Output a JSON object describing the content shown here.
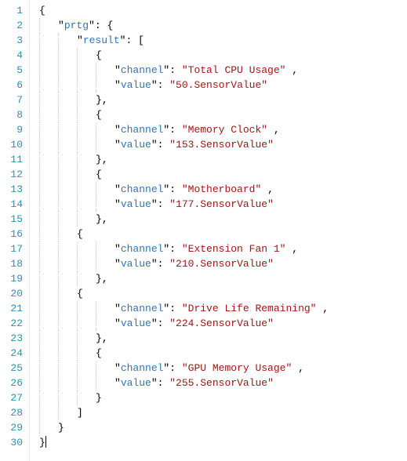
{
  "lines": [
    {
      "num": "1",
      "indent": 0,
      "segments": [
        {
          "type": "brace",
          "text": "{"
        }
      ]
    },
    {
      "num": "2",
      "indent": 1,
      "segments": [
        {
          "type": "quote",
          "text": "\""
        },
        {
          "type": "key",
          "text": "prtg"
        },
        {
          "type": "quote",
          "text": "\""
        },
        {
          "type": "colon",
          "text": ": "
        },
        {
          "type": "brace",
          "text": "{"
        }
      ]
    },
    {
      "num": "3",
      "indent": 2,
      "segments": [
        {
          "type": "quote",
          "text": "\""
        },
        {
          "type": "key",
          "text": "result"
        },
        {
          "type": "quote",
          "text": "\""
        },
        {
          "type": "colon",
          "text": ": "
        },
        {
          "type": "bracket",
          "text": "["
        }
      ]
    },
    {
      "num": "4",
      "indent": 3,
      "segments": [
        {
          "type": "brace",
          "text": "{"
        }
      ]
    },
    {
      "num": "5",
      "indent": 4,
      "segments": [
        {
          "type": "quote",
          "text": "\""
        },
        {
          "type": "key",
          "text": "channel"
        },
        {
          "type": "quote",
          "text": "\""
        },
        {
          "type": "colon",
          "text": ": "
        },
        {
          "type": "string",
          "text": "\"Total CPU Usage\""
        },
        {
          "type": "comma",
          "text": " ,"
        }
      ]
    },
    {
      "num": "6",
      "indent": 4,
      "segments": [
        {
          "type": "quote",
          "text": "\""
        },
        {
          "type": "key",
          "text": "value"
        },
        {
          "type": "quote",
          "text": "\""
        },
        {
          "type": "colon",
          "text": ": "
        },
        {
          "type": "string",
          "text": "\"50.SensorValue\""
        }
      ]
    },
    {
      "num": "7",
      "indent": 3,
      "segments": [
        {
          "type": "brace",
          "text": "}"
        },
        {
          "type": "comma",
          "text": ","
        }
      ]
    },
    {
      "num": "8",
      "indent": 3,
      "segments": [
        {
          "type": "brace",
          "text": "{"
        }
      ]
    },
    {
      "num": "9",
      "indent": 4,
      "segments": [
        {
          "type": "quote",
          "text": "\""
        },
        {
          "type": "key",
          "text": "channel"
        },
        {
          "type": "quote",
          "text": "\""
        },
        {
          "type": "colon",
          "text": ": "
        },
        {
          "type": "string",
          "text": "\"Memory Clock\""
        },
        {
          "type": "comma",
          "text": " ,"
        }
      ]
    },
    {
      "num": "10",
      "indent": 4,
      "segments": [
        {
          "type": "quote",
          "text": "\""
        },
        {
          "type": "key",
          "text": "value"
        },
        {
          "type": "quote",
          "text": "\""
        },
        {
          "type": "colon",
          "text": ": "
        },
        {
          "type": "string",
          "text": "\"153.SensorValue\""
        }
      ]
    },
    {
      "num": "11",
      "indent": 3,
      "segments": [
        {
          "type": "brace",
          "text": "}"
        },
        {
          "type": "comma",
          "text": ","
        }
      ]
    },
    {
      "num": "12",
      "indent": 3,
      "segments": [
        {
          "type": "brace",
          "text": "{"
        }
      ]
    },
    {
      "num": "13",
      "indent": 4,
      "segments": [
        {
          "type": "quote",
          "text": "\""
        },
        {
          "type": "key",
          "text": "channel"
        },
        {
          "type": "quote",
          "text": "\""
        },
        {
          "type": "colon",
          "text": ": "
        },
        {
          "type": "string",
          "text": "\"Motherboard\""
        },
        {
          "type": "comma",
          "text": " ,"
        }
      ]
    },
    {
      "num": "14",
      "indent": 4,
      "segments": [
        {
          "type": "quote",
          "text": "\""
        },
        {
          "type": "key",
          "text": "value"
        },
        {
          "type": "quote",
          "text": "\""
        },
        {
          "type": "colon",
          "text": ": "
        },
        {
          "type": "string",
          "text": "\"177.SensorValue\""
        }
      ]
    },
    {
      "num": "15",
      "indent": 3,
      "segments": [
        {
          "type": "brace",
          "text": "}"
        },
        {
          "type": "comma",
          "text": ","
        }
      ]
    },
    {
      "num": "16",
      "indent": 2,
      "segments": [
        {
          "type": "brace",
          "text": "{"
        }
      ]
    },
    {
      "num": "17",
      "indent": 4,
      "segments": [
        {
          "type": "quote",
          "text": "\""
        },
        {
          "type": "key",
          "text": "channel"
        },
        {
          "type": "quote",
          "text": "\""
        },
        {
          "type": "colon",
          "text": ": "
        },
        {
          "type": "string",
          "text": "\"Extension Fan 1\""
        },
        {
          "type": "comma",
          "text": " ,"
        }
      ]
    },
    {
      "num": "18",
      "indent": 4,
      "segments": [
        {
          "type": "quote",
          "text": "\""
        },
        {
          "type": "key",
          "text": "value"
        },
        {
          "type": "quote",
          "text": "\""
        },
        {
          "type": "colon",
          "text": ": "
        },
        {
          "type": "string",
          "text": "\"210.SensorValue\""
        }
      ]
    },
    {
      "num": "19",
      "indent": 3,
      "segments": [
        {
          "type": "brace",
          "text": "}"
        },
        {
          "type": "comma",
          "text": ","
        }
      ]
    },
    {
      "num": "20",
      "indent": 2,
      "segments": [
        {
          "type": "brace",
          "text": "{"
        }
      ]
    },
    {
      "num": "21",
      "indent": 4,
      "segments": [
        {
          "type": "quote",
          "text": "\""
        },
        {
          "type": "key",
          "text": "channel"
        },
        {
          "type": "quote",
          "text": "\""
        },
        {
          "type": "colon",
          "text": ": "
        },
        {
          "type": "string",
          "text": "\"Drive Life Remaining\""
        },
        {
          "type": "comma",
          "text": " ,"
        }
      ]
    },
    {
      "num": "22",
      "indent": 4,
      "segments": [
        {
          "type": "quote",
          "text": "\""
        },
        {
          "type": "key",
          "text": "value"
        },
        {
          "type": "quote",
          "text": "\""
        },
        {
          "type": "colon",
          "text": ": "
        },
        {
          "type": "string",
          "text": "\"224.SensorValue\""
        }
      ]
    },
    {
      "num": "23",
      "indent": 3,
      "segments": [
        {
          "type": "brace",
          "text": "}"
        },
        {
          "type": "comma",
          "text": ","
        }
      ]
    },
    {
      "num": "24",
      "indent": 3,
      "segments": [
        {
          "type": "brace",
          "text": "{"
        }
      ]
    },
    {
      "num": "25",
      "indent": 4,
      "segments": [
        {
          "type": "quote",
          "text": "\""
        },
        {
          "type": "key",
          "text": "channel"
        },
        {
          "type": "quote",
          "text": "\""
        },
        {
          "type": "colon",
          "text": ": "
        },
        {
          "type": "string",
          "text": "\"GPU Memory Usage\""
        },
        {
          "type": "comma",
          "text": " ,"
        }
      ]
    },
    {
      "num": "26",
      "indent": 4,
      "segments": [
        {
          "type": "quote",
          "text": "\""
        },
        {
          "type": "key",
          "text": "value"
        },
        {
          "type": "quote",
          "text": "\""
        },
        {
          "type": "colon",
          "text": ": "
        },
        {
          "type": "string",
          "text": "\"255.SensorValue\""
        }
      ]
    },
    {
      "num": "27",
      "indent": 3,
      "segments": [
        {
          "type": "brace",
          "text": "}"
        }
      ]
    },
    {
      "num": "28",
      "indent": 2,
      "segments": [
        {
          "type": "bracket",
          "text": "]"
        }
      ]
    },
    {
      "num": "29",
      "indent": 1,
      "segments": [
        {
          "type": "brace",
          "text": "}"
        }
      ]
    },
    {
      "num": "30",
      "indent": 0,
      "segments": [
        {
          "type": "brace",
          "text": "}"
        }
      ],
      "cursor": true
    }
  ],
  "indentWidth": 24,
  "baseIndent": 8
}
